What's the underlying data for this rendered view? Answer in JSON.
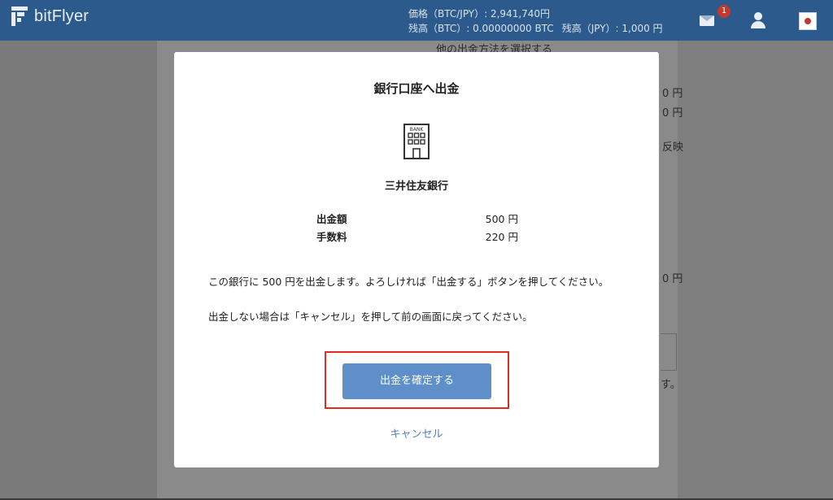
{
  "header": {
    "logo_text": "bitFlyer",
    "ticker_line1": "価格（BTC/JPY）: 2,941,740円",
    "ticker_line2_btc": "残高（BTC）: 0.00000000 BTC",
    "ticker_line2_jpy": "残高（JPY）: 1,000 円",
    "mail_badge": "1"
  },
  "background": {
    "other_method_link": "他の出金方法を選択する",
    "right_text_1": "0 円",
    "right_text_2": "0 円",
    "right_text_3": "反映",
    "right_text_4": "0 円",
    "right_text_5": "す。"
  },
  "modal": {
    "title": "銀行口座へ出金",
    "bank_icon_label": "BANK",
    "bank_name": "三井住友銀行",
    "rows": [
      {
        "label": "出金額",
        "value": "500 円"
      },
      {
        "label": "手数料",
        "value": "220 円"
      }
    ],
    "message_1": "この銀行に 500 円を出金します。よろしければ「出金する」ボタンを押してください。",
    "message_2": "出金しない場合は「キャンセル」を押して前の画面に戻ってください。",
    "confirm_button": "出金を確定する",
    "cancel_link": "キャンセル"
  },
  "colors": {
    "header_bg": "#2d5a8c",
    "button_bg": "#5f8fc8",
    "link": "#4d7fbf",
    "highlight_border": "#e32b22"
  },
  "icons": [
    "logo-mark-icon",
    "mail-icon",
    "user-icon",
    "flag-japan-icon",
    "bank-building-icon"
  ]
}
